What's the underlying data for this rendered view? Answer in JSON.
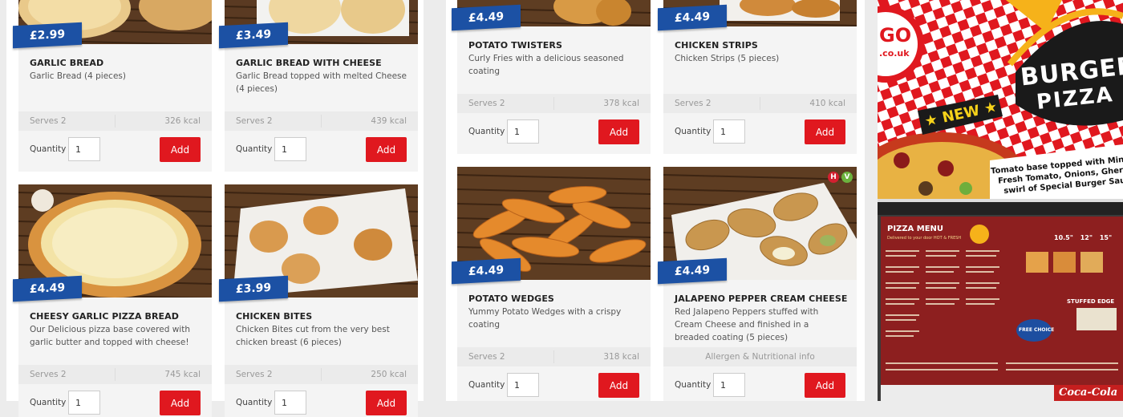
{
  "products": [
    {
      "title": "GARLIC BREAD",
      "price": "£2.99",
      "desc": "Garlic Bread (4 pieces)",
      "serves": "Serves 2",
      "kcal": "326 kcal",
      "qty_label": "Quantity",
      "qty_value": "1",
      "add_label": "Add"
    },
    {
      "title": "GARLIC BREAD WITH CHEESE",
      "price": "£3.49",
      "desc": "Garlic Bread topped with melted Cheese (4 pieces)",
      "serves": "Serves 2",
      "kcal": "439 kcal",
      "qty_label": "Quantity",
      "qty_value": "1",
      "add_label": "Add"
    },
    {
      "title": "CHEESY GARLIC PIZZA BREAD",
      "price": "£4.49",
      "desc": "Our Delicious pizza base covered with garlic butter and topped with cheese!",
      "serves": "Serves 2",
      "kcal": "745 kcal",
      "qty_label": "Quantity",
      "qty_value": "1",
      "add_label": "Add"
    },
    {
      "title": "CHICKEN BITES",
      "price": "£3.99",
      "desc": "Chicken Bites cut from the very best chicken breast (6 pieces)",
      "serves": "Serves 2",
      "kcal": "250 kcal",
      "qty_label": "Quantity",
      "qty_value": "1",
      "add_label": "Add"
    },
    {
      "title": "POTATO TWISTERS",
      "price": "£4.49",
      "desc": "Curly Fries with a delicious seasoned coating",
      "serves": "Serves 2",
      "kcal": "378 kcal",
      "qty_label": "Quantity",
      "qty_value": "1",
      "add_label": "Add"
    },
    {
      "title": "CHICKEN STRIPS",
      "price": "£4.49",
      "desc": "Chicken Strips (5 pieces)",
      "serves": "Serves 2",
      "kcal": "410 kcal",
      "qty_label": "Quantity",
      "qty_value": "1",
      "add_label": "Add"
    },
    {
      "title": "POTATO WEDGES",
      "price": "£4.49",
      "desc": "Yummy Potato Wedges with a crispy coating",
      "serves": "Serves 2",
      "kcal": "318 kcal",
      "qty_label": "Quantity",
      "qty_value": "1",
      "add_label": "Add"
    },
    {
      "title": "JALAPENO PEPPER CREAM CHEESE",
      "price": "£4.49",
      "desc": "Red Jalapeno Peppers stuffed with Cream Cheese and finished in a breaded coating (5 pieces)",
      "allergen": "Allergen & Nutritional info",
      "badge_h": "H",
      "badge_v": "V",
      "qty_label": "Quantity",
      "qty_value": "1",
      "add_label": "Add"
    }
  ],
  "ads": {
    "promo": {
      "logo": "GO",
      "site": ".co.uk",
      "headline_1": "BURGER",
      "headline_2": "PIZZA",
      "tag": "NEW",
      "desc_1": "Tomato base topped with Mini Bee",
      "desc_2": "Fresh Tomato, Onions, Gherkins",
      "desc_3": "swirl of Special Burger Sau"
    },
    "menu_board": {
      "title": "PIZZA MENU",
      "subtitle": "Delivered to your door HOT & FRESH",
      "sizes": [
        "10.5\"",
        "12\"",
        "15\""
      ],
      "free_choice": "FREE CHOICE",
      "stuffed_edge": "STUFFED EDGE",
      "brand": "Coca-Cola"
    }
  },
  "colors": {
    "accent": "#e0181f",
    "price_tag": "#1c51a4",
    "card_bg": "#f4f4f4"
  }
}
